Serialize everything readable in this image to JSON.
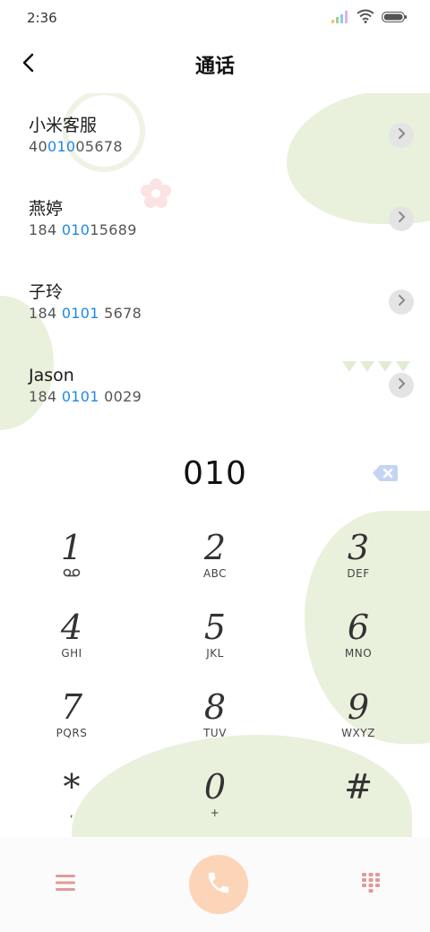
{
  "status": {
    "time": "2:36"
  },
  "header": {
    "title": "通话"
  },
  "contacts": [
    {
      "name": "小米客服",
      "number_pre": "40",
      "number_hl": "010",
      "number_post": "05678"
    },
    {
      "name": "燕婷",
      "number_pre": "184 ",
      "number_hl": "010",
      "number_post": "15689"
    },
    {
      "name": "子玲",
      "number_pre": "184 ",
      "number_hl": "0101",
      "number_post": " 5678"
    },
    {
      "name": "Jason",
      "number_pre": "184 ",
      "number_hl": "0101",
      "number_post": " 0029"
    }
  ],
  "dialer": {
    "input": "010"
  },
  "keypad": [
    {
      "digit": "1",
      "letters": ""
    },
    {
      "digit": "2",
      "letters": "ABC"
    },
    {
      "digit": "3",
      "letters": "DEF"
    },
    {
      "digit": "4",
      "letters": "GHI"
    },
    {
      "digit": "5",
      "letters": "JKL"
    },
    {
      "digit": "6",
      "letters": "MNO"
    },
    {
      "digit": "7",
      "letters": "PQRS"
    },
    {
      "digit": "8",
      "letters": "TUV"
    },
    {
      "digit": "9",
      "letters": "WXYZ"
    },
    {
      "digit": "*",
      "letters": ","
    },
    {
      "digit": "0",
      "letters": "+"
    },
    {
      "digit": "#",
      "letters": ""
    }
  ],
  "colors": {
    "accent_blue": "#1e88e5",
    "call_button": "#fcd4b8",
    "menu_icon": "#e19a98",
    "backspace": "#c6d4f4",
    "decor_green": "#e9f0dc"
  },
  "icons": {
    "back": "chevron-left-icon",
    "detail": "chevron-right-icon",
    "backspace": "backspace-icon",
    "voicemail": "voicemail-icon",
    "menu": "menu-icon",
    "call": "phone-icon",
    "dialpad": "dialpad-icon"
  }
}
